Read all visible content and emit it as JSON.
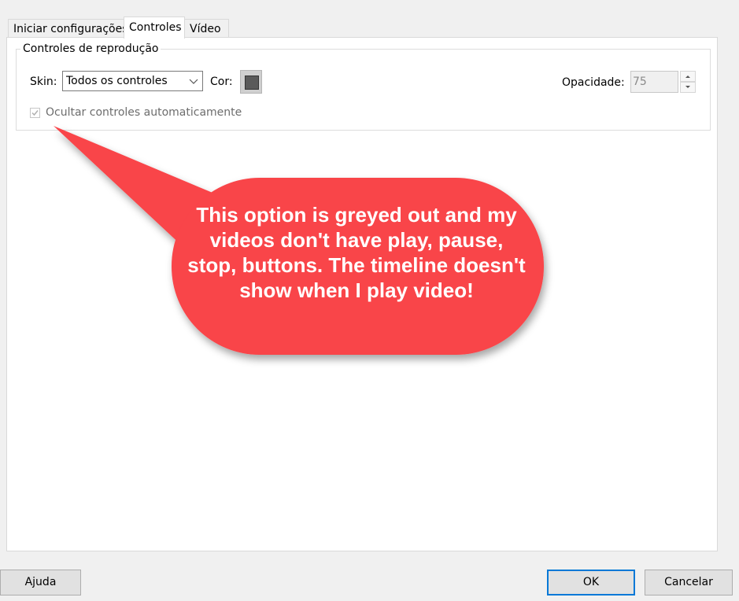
{
  "tabs": [
    {
      "label": "Iniciar configurações",
      "active": false
    },
    {
      "label": "Controles",
      "active": true
    },
    {
      "label": "Vídeo",
      "active": false
    }
  ],
  "group": {
    "title": "Controles de reprodução",
    "skin_label": "Skin:",
    "skin_value": "Todos os controles",
    "color_label": "Cor:",
    "color_value": "#5a5a5a",
    "opacity_label": "Opacidade:",
    "opacity_value": "75",
    "auto_hide_label": "Ocultar controles automaticamente",
    "auto_hide_checked": true,
    "auto_hide_disabled": true
  },
  "buttons": {
    "help": "Ajuda",
    "ok": "OK",
    "cancel": "Cancelar"
  },
  "annotation": {
    "text": "This option is greyed out and my videos don't have play, pause, stop, buttons. The timeline doesn't show when I play video!",
    "color": "#f94449"
  }
}
